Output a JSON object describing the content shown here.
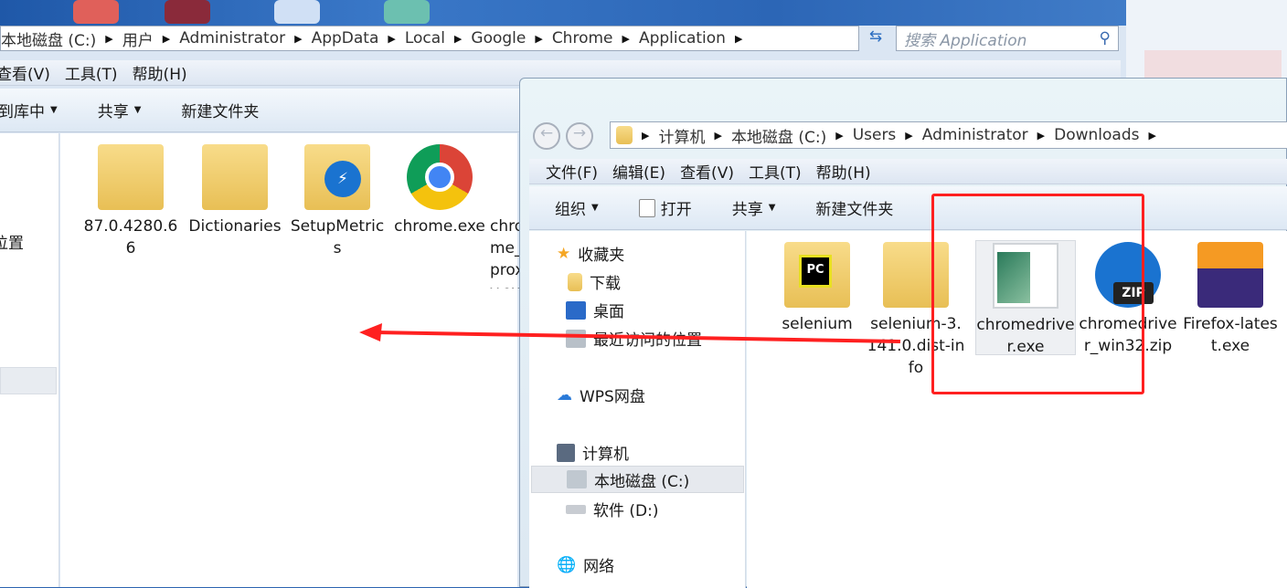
{
  "back_window": {
    "breadcrumb": [
      "本地磁盘 (C:)",
      "用户",
      "Administrator",
      "AppData",
      "Local",
      "Google",
      "Chrome",
      "Application"
    ],
    "search_placeholder": "搜索 Application",
    "menu": [
      "查看(V)",
      "工具(T)",
      "帮助(H)"
    ],
    "toolbar": {
      "include_library": "包含到库中",
      "share": "共享",
      "new_folder": "新建文件夹"
    },
    "nav_partial": "位置",
    "files": [
      {
        "name": "87.0.4280.66",
        "icon": "folder-icon"
      },
      {
        "name": "Dictionaries",
        "icon": "folder-icon"
      },
      {
        "name": "SetupMetrics",
        "icon": "folder-icon"
      },
      {
        "name": "chrome.exe",
        "icon": "chrome-icon"
      },
      {
        "name": "chrome_proxy.exe"
      }
    ]
  },
  "front_window": {
    "breadcrumb": [
      "计算机",
      "本地磁盘 (C:)",
      "Users",
      "Administrator",
      "Downloads"
    ],
    "menu": [
      "文件(F)",
      "编辑(E)",
      "查看(V)",
      "工具(T)",
      "帮助(H)"
    ],
    "toolbar": {
      "organize": "组织",
      "open": "打开",
      "share": "共享",
      "new_folder": "新建文件夹"
    },
    "nav": {
      "favorites": "收藏夹",
      "downloads": "下载",
      "desktop": "桌面",
      "recent": "最近访问的位置",
      "wps": "WPS网盘",
      "computer": "计算机",
      "local_disk": "本地磁盘 (C:)",
      "software": "软件 (D:)",
      "network": "网络"
    },
    "files": [
      {
        "name": "selenium",
        "icon": "pycharm-folder-icon"
      },
      {
        "name": "selenium-3.141.0.dist-info",
        "icon": "folder-icon"
      },
      {
        "name": "chromedriver.exe",
        "icon": "exe-icon",
        "selected": true
      },
      {
        "name": "chromedriver_win32.zip",
        "icon": "zip-icon"
      },
      {
        "name": "Firefox-latest.exe",
        "icon": "firefox-icon"
      }
    ]
  },
  "annotation": {
    "color": "#ff2020"
  }
}
